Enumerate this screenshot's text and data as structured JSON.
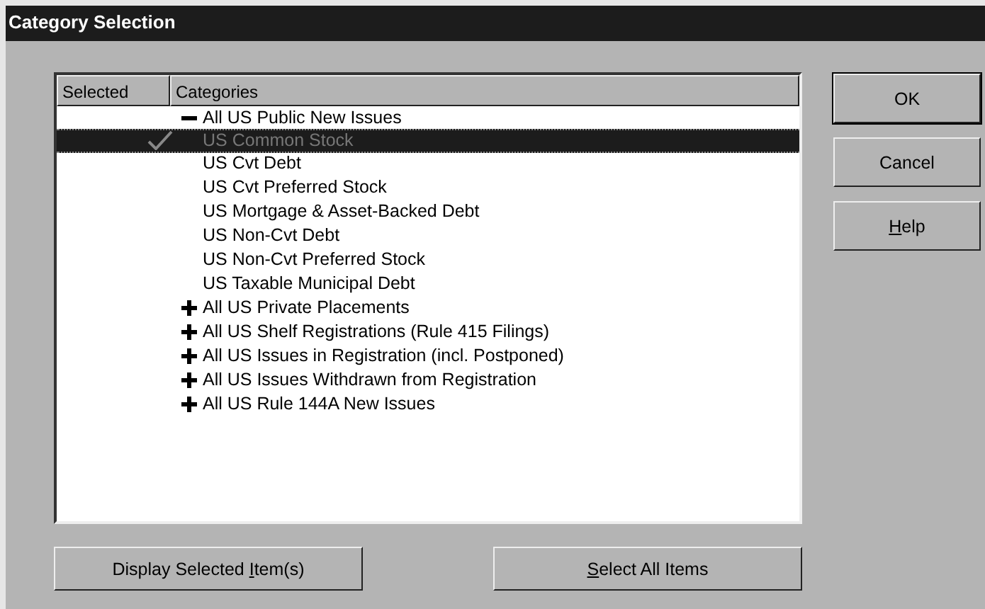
{
  "window": {
    "title": "Category Selection"
  },
  "list": {
    "columns": [
      "Selected",
      "Categories"
    ],
    "items": [
      {
        "label": "All US Public New Issues",
        "expanded": true,
        "checked": false,
        "selected": false,
        "children": [
          {
            "label": "US Common Stock",
            "checked": true,
            "selected": true
          },
          {
            "label": "US Cvt Debt",
            "checked": false,
            "selected": false
          },
          {
            "label": "US Cvt Preferred Stock",
            "checked": false,
            "selected": false
          },
          {
            "label": "US Mortgage & Asset-Backed Debt",
            "checked": false,
            "selected": false
          },
          {
            "label": "US Non-Cvt Debt",
            "checked": false,
            "selected": false
          },
          {
            "label": "US Non-Cvt Preferred Stock",
            "checked": false,
            "selected": false
          },
          {
            "label": "US Taxable Municipal Debt",
            "checked": false,
            "selected": false
          }
        ]
      },
      {
        "label": "All US Private Placements",
        "expanded": false,
        "checked": false,
        "selected": false
      },
      {
        "label": "All US Shelf Registrations (Rule 415 Filings)",
        "expanded": false,
        "checked": false,
        "selected": false
      },
      {
        "label": "All US Issues in Registration (incl. Postponed)",
        "expanded": false,
        "checked": false,
        "selected": false
      },
      {
        "label": "All US Issues Withdrawn from Registration",
        "expanded": false,
        "checked": false,
        "selected": false
      },
      {
        "label": "All US Rule 144A New Issues",
        "expanded": false,
        "checked": false,
        "selected": false
      }
    ]
  },
  "side_buttons": [
    {
      "label": {
        "before": "OK"
      },
      "default": true
    },
    {
      "label": {
        "before": "Cancel"
      },
      "default": false
    },
    {
      "label": {
        "key": "H",
        "after": "elp"
      },
      "default": false
    }
  ],
  "bottom_buttons": [
    {
      "label": {
        "before": "Display Selected ",
        "key": "I",
        "after": "tem(s)"
      }
    },
    {
      "label": {
        "key": "S",
        "after": "elect All Items"
      }
    }
  ]
}
